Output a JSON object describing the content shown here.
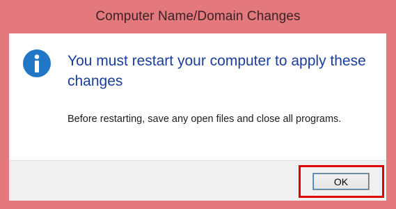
{
  "dialog": {
    "title": "Computer Name/Domain Changes",
    "icon": "information-icon",
    "main_instruction": "You must restart your computer to apply these changes",
    "content": "Before restarting, save any open files and close all programs.",
    "ok_label": "OK"
  },
  "colors": {
    "title_bar": "#e3787d",
    "main_instruction_text": "#1a3e9a",
    "info_icon": "#1f77c5",
    "highlight_box": "#e00000",
    "footer_background": "#f0f0f0"
  }
}
